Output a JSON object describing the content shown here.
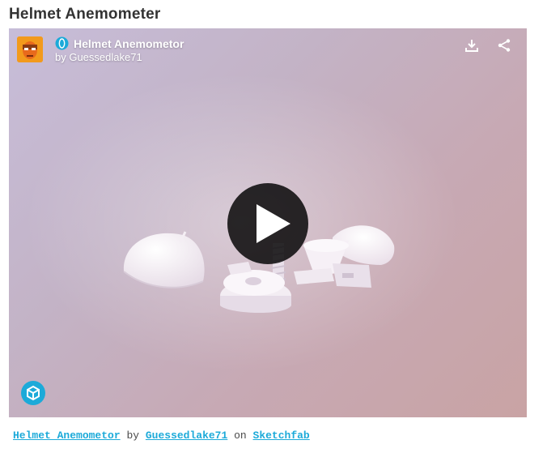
{
  "page": {
    "title": "Helmet Anemometer"
  },
  "viewer": {
    "model_name": "Helmet Anemometor",
    "byline": "by Guessedlake71",
    "actions": [
      "download-icon",
      "share-icon"
    ],
    "brand_color": "#1caad9"
  },
  "footer": {
    "model_link": "Helmet Anemometor",
    "by": "by",
    "author_link": "Guessedlake71",
    "on": "on",
    "platform_link": "Sketchfab"
  }
}
